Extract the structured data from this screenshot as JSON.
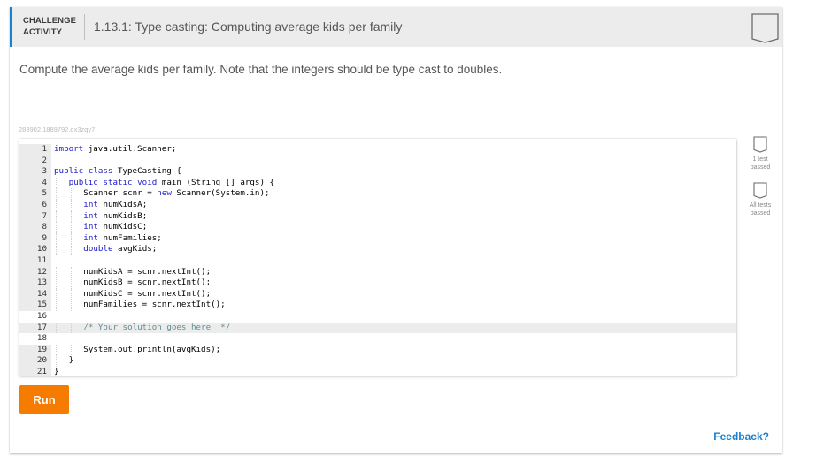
{
  "header": {
    "activity_type_line1": "CHALLENGE",
    "activity_type_line2": "ACTIVITY",
    "title": "1.13.1: Type casting: Computing average kids per family",
    "completion_badge_icon": "completion-badge-outline-icon"
  },
  "instructions": "Compute the average kids per family. Note that the integers should be type cast to doubles.",
  "code_id": "283902.1889792.qx3zqy7",
  "editor": {
    "active_line": 17,
    "lines": [
      {
        "n": "1",
        "indent": 0,
        "tokens": [
          {
            "t": "import",
            "k": "kw"
          },
          {
            "t": " java.util.Scanner;"
          }
        ]
      },
      {
        "n": "2",
        "indent": 0,
        "tokens": []
      },
      {
        "n": "3",
        "indent": 0,
        "tokens": [
          {
            "t": "public",
            "k": "kw"
          },
          {
            "t": " "
          },
          {
            "t": "class",
            "k": "kw"
          },
          {
            "t": " TypeCasting {"
          }
        ]
      },
      {
        "n": "4",
        "indent": 1,
        "tokens": [
          {
            "t": "public",
            "k": "kw"
          },
          {
            "t": " "
          },
          {
            "t": "static",
            "k": "kw"
          },
          {
            "t": " "
          },
          {
            "t": "void",
            "k": "kw"
          },
          {
            "t": " main (String [] args) {"
          }
        ]
      },
      {
        "n": "5",
        "indent": 2,
        "tokens": [
          {
            "t": "Scanner scnr = "
          },
          {
            "t": "new",
            "k": "kw"
          },
          {
            "t": " Scanner(System.in);"
          }
        ]
      },
      {
        "n": "6",
        "indent": 2,
        "tokens": [
          {
            "t": "int",
            "k": "kw"
          },
          {
            "t": " numKidsA;"
          }
        ]
      },
      {
        "n": "7",
        "indent": 2,
        "tokens": [
          {
            "t": "int",
            "k": "kw"
          },
          {
            "t": " numKidsB;"
          }
        ]
      },
      {
        "n": "8",
        "indent": 2,
        "tokens": [
          {
            "t": "int",
            "k": "kw"
          },
          {
            "t": " numKidsC;"
          }
        ]
      },
      {
        "n": "9",
        "indent": 2,
        "tokens": [
          {
            "t": "int",
            "k": "kw"
          },
          {
            "t": " numFamilies;"
          }
        ]
      },
      {
        "n": "10",
        "indent": 2,
        "tokens": [
          {
            "t": "double",
            "k": "kw"
          },
          {
            "t": " avgKids;"
          }
        ]
      },
      {
        "n": "11",
        "indent": 0,
        "tokens": []
      },
      {
        "n": "12",
        "indent": 2,
        "tokens": [
          {
            "t": "numKidsA = scnr.nextInt();"
          }
        ]
      },
      {
        "n": "13",
        "indent": 2,
        "tokens": [
          {
            "t": "numKidsB = scnr.nextInt();"
          }
        ]
      },
      {
        "n": "14",
        "indent": 2,
        "tokens": [
          {
            "t": "numKidsC = scnr.nextInt();"
          }
        ]
      },
      {
        "n": "15",
        "indent": 2,
        "tokens": [
          {
            "t": "numFamilies = scnr.nextInt();"
          }
        ]
      },
      {
        "n": "16",
        "indent": 0,
        "tokens": []
      },
      {
        "n": "17",
        "indent": 2,
        "tokens": [
          {
            "t": "/* Your solution goes here  */",
            "k": "cm"
          }
        ]
      },
      {
        "n": "18",
        "indent": 0,
        "tokens": []
      },
      {
        "n": "19",
        "indent": 2,
        "tokens": [
          {
            "t": "System.out.println(avgKids);"
          }
        ]
      },
      {
        "n": "20",
        "indent": 1,
        "tokens": [
          {
            "t": "}"
          }
        ]
      },
      {
        "n": "21",
        "indent": 0,
        "tokens": [
          {
            "t": "}"
          }
        ]
      }
    ],
    "plain_gutter_lines": [
      "16",
      "18"
    ]
  },
  "test_badges": [
    {
      "label": "1 test passed",
      "icon": "test-badge-outline-icon"
    },
    {
      "label": "All tests passed",
      "icon": "test-badge-outline-icon"
    }
  ],
  "run_button": "Run",
  "feedback_link": "Feedback?",
  "colors": {
    "accent_blue": "#1b7fcc",
    "run_orange": "#f57c00",
    "keyword": "#1a1acd",
    "comment": "#5f8f8f"
  }
}
